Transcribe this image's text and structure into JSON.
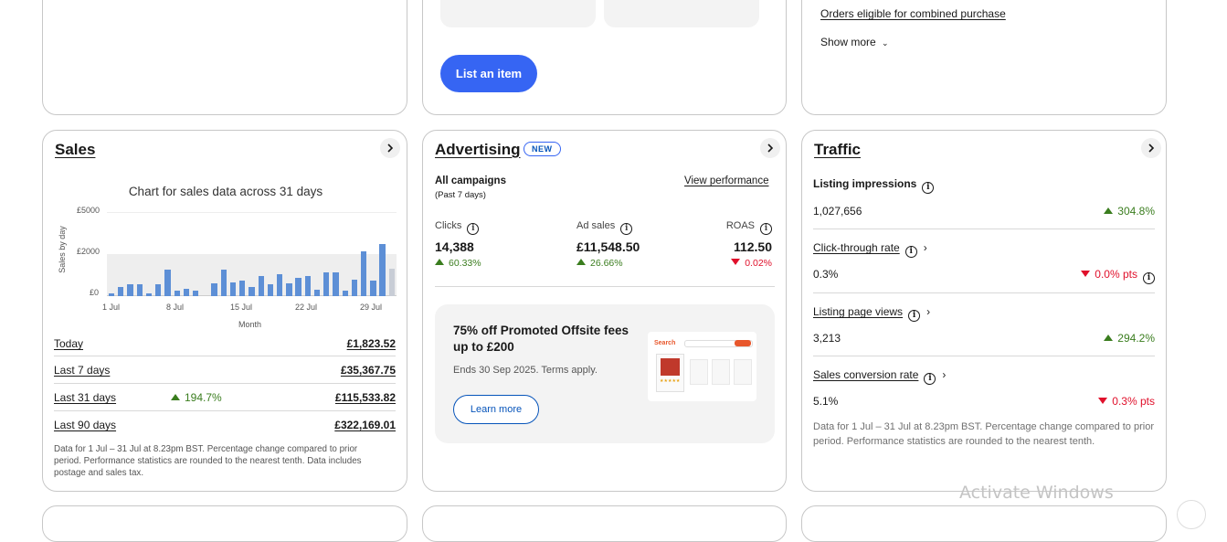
{
  "top_row": {
    "list_item_button": "List an item",
    "orders_link": "Orders eligible for combined purchase",
    "show_more": "Show more"
  },
  "sales": {
    "title": "Sales",
    "chart_title": "Chart for sales data across 31 days",
    "rows": [
      {
        "label": "Today",
        "value": "£1,823.52",
        "change": ""
      },
      {
        "label": "Last 7 days",
        "value": "£35,367.75",
        "change": ""
      },
      {
        "label": "Last 31 days",
        "value": "£115,533.82",
        "change": "194.7%"
      },
      {
        "label": "Last 90 days",
        "value": "£322,169.01",
        "change": ""
      }
    ],
    "footnote": "Data for 1 Jul – 31 Jul at 8.23pm BST. Percentage change compared to prior period. Performance statistics are rounded to the nearest tenth. Data includes postage and sales tax."
  },
  "chart_data": {
    "type": "bar",
    "title": "Chart for sales data across 31 days",
    "xlabel": "Month",
    "ylabel": "Sales by day",
    "ylim": [
      0,
      5000
    ],
    "y_ticks": [
      "£5000",
      "£2000",
      "£0"
    ],
    "x_ticks": [
      "1 Jul",
      "8 Jul",
      "15 Jul",
      "22 Jul",
      "29 Jul"
    ],
    "categories": [
      "1",
      "2",
      "3",
      "4",
      "5",
      "6",
      "7",
      "8",
      "9",
      "10",
      "11",
      "12",
      "13",
      "14",
      "15",
      "16",
      "17",
      "18",
      "19",
      "20",
      "21",
      "22",
      "23",
      "24",
      "25",
      "26",
      "27",
      "28",
      "29",
      "30",
      "31"
    ],
    "values": [
      180,
      550,
      700,
      700,
      180,
      700,
      1600,
      350,
      450,
      350,
      0,
      750,
      1600,
      850,
      950,
      550,
      1200,
      700,
      1300,
      750,
      1100,
      1200,
      400,
      1450,
      1450,
      350,
      1000,
      2700,
      950,
      3150,
      1650
    ],
    "highlight_band": [
      0,
      2000
    ],
    "grid": true
  },
  "advertising": {
    "title": "Advertising",
    "badge": "NEW",
    "campaign_label": "All campaigns",
    "campaign_period": "(Past 7 days)",
    "view_performance": "View performance",
    "metrics": [
      {
        "label": "Clicks",
        "value": "14,388",
        "change": "60.33%",
        "direction": "up"
      },
      {
        "label": "Ad sales",
        "value": "£11,548.50",
        "change": "26.66%",
        "direction": "up"
      },
      {
        "label": "ROAS",
        "value": "112.50",
        "change": "0.02%",
        "direction": "down"
      }
    ],
    "promo": {
      "headline": "75% off Promoted Offsite fees up to £200",
      "subtext": "Ends 30 Sep 2025. Terms apply.",
      "button": "Learn more",
      "illustration_search": "Search"
    }
  },
  "traffic": {
    "title": "Traffic",
    "rows": [
      {
        "label": "Listing impressions",
        "value": "1,027,656",
        "change": "304.8%",
        "direction": "up",
        "is_link": false
      },
      {
        "label": "Click-through rate",
        "value": "0.3%",
        "change": "0.0% pts",
        "direction": "down",
        "is_link": true
      },
      {
        "label": "Listing page views",
        "value": "3,213",
        "change": "294.2%",
        "direction": "up",
        "is_link": true
      },
      {
        "label": "Sales conversion rate",
        "value": "5.1%",
        "change": "0.3% pts",
        "direction": "down",
        "is_link": true
      }
    ],
    "footnote": "Data for 1 Jul – 31 Jul at 8.23pm BST. Percentage change compared to prior period. Performance statistics are rounded to the nearest tenth."
  },
  "watermark": "Activate Windows",
  "colors": {
    "primary_blue": "#0654ba",
    "button_blue": "#3665f3",
    "chart_bar": "#5d8fd6",
    "up_green": "#3a7d1e",
    "down_red": "#e0102b"
  }
}
